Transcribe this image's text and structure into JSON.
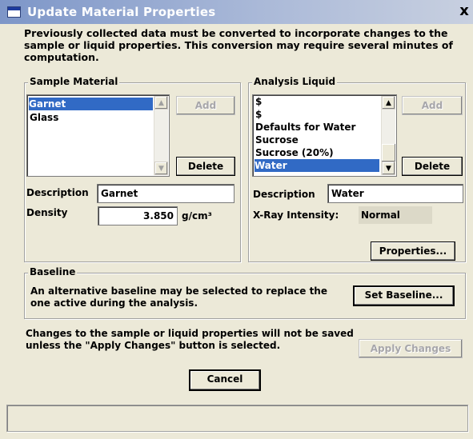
{
  "window": {
    "title": "Update Material Properties",
    "close_label": "x"
  },
  "intro_text": "Previously collected data must be converted to incorporate changes to the sample or liquid properties.  This conversion may require several minutes of computation.",
  "sample_material": {
    "legend": "Sample Material",
    "items": [
      "Garnet",
      "Glass"
    ],
    "selected": "Garnet",
    "add_label": "Add",
    "delete_label": "Delete",
    "description_label": "Description",
    "description_value": "Garnet",
    "density_label": "Density",
    "density_value": "3.850",
    "density_unit": "g/cm³"
  },
  "analysis_liquid": {
    "legend": "Analysis Liquid",
    "items": [
      "$",
      "$",
      "Defaults for Water",
      "Sucrose",
      "Sucrose (20%)",
      "Water"
    ],
    "selected": "Water",
    "add_label": "Add",
    "delete_label": "Delete",
    "description_label": "Description",
    "description_value": "Water",
    "xray_label": "X-Ray Intensity:",
    "xray_value": "Normal",
    "properties_label": "Properties..."
  },
  "baseline": {
    "legend": "Baseline",
    "text": "An alternative baseline may be selected to replace the one active during the analysis.",
    "button_label": "Set Baseline..."
  },
  "apply": {
    "text": "Changes to the sample or liquid properties will not be saved unless the \"Apply Changes\" button is selected.",
    "button_label": "Apply Changes"
  },
  "cancel_label": "Cancel",
  "colors": {
    "dialog_bg": "#ece9d8",
    "selection": "#316ac5",
    "title_gradient_start": "#7d96c8"
  }
}
